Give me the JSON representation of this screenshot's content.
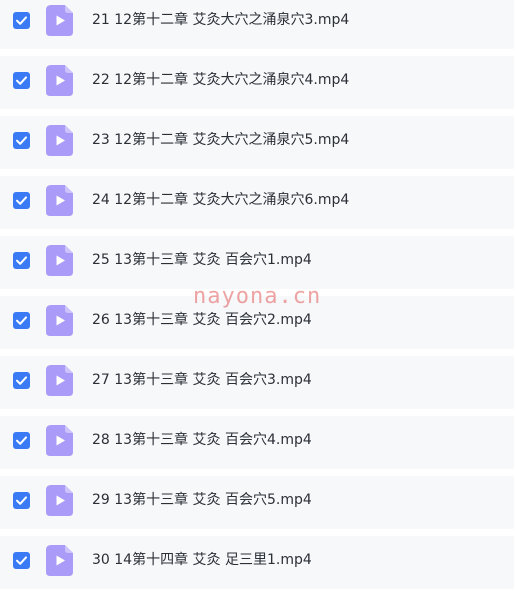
{
  "files": [
    {
      "name": "21 12第十二章 艾灸大穴之涌泉穴3.mp4",
      "checked": true,
      "icon": "video-play-icon"
    },
    {
      "name": "22 12第十二章 艾灸大穴之涌泉穴4.mp4",
      "checked": true,
      "icon": "video-play-icon"
    },
    {
      "name": "23 12第十二章 艾灸大穴之涌泉穴5.mp4",
      "checked": true,
      "icon": "video-play-icon"
    },
    {
      "name": "24 12第十二章 艾灸大穴之涌泉穴6.mp4",
      "checked": true,
      "icon": "video-play-icon"
    },
    {
      "name": "25 13第十三章 艾灸 百会穴1.mp4",
      "checked": true,
      "icon": "video-play-icon"
    },
    {
      "name": "26 13第十三章 艾灸 百会穴2.mp4",
      "checked": true,
      "icon": "video-play-icon"
    },
    {
      "name": "27 13第十三章 艾灸 百会穴3.mp4",
      "checked": true,
      "icon": "video-play-icon"
    },
    {
      "name": "28 13第十三章 艾灸 百会穴4.mp4",
      "checked": true,
      "icon": "video-play-icon"
    },
    {
      "name": "29 13第十三章 艾灸 百会穴5.mp4",
      "checked": true,
      "icon": "video-play-icon"
    },
    {
      "name": "30 14第十四章 艾灸 足三里1.mp4",
      "checked": true,
      "icon": "video-play-icon"
    }
  ],
  "watermark": "nayona.cn",
  "colors": {
    "checkbox": "#3a7bf5",
    "icon_body": "#a99bf7",
    "icon_fold": "#cdc4fb",
    "row_background": "#f7f8fa",
    "watermark": "#e15a5a"
  }
}
